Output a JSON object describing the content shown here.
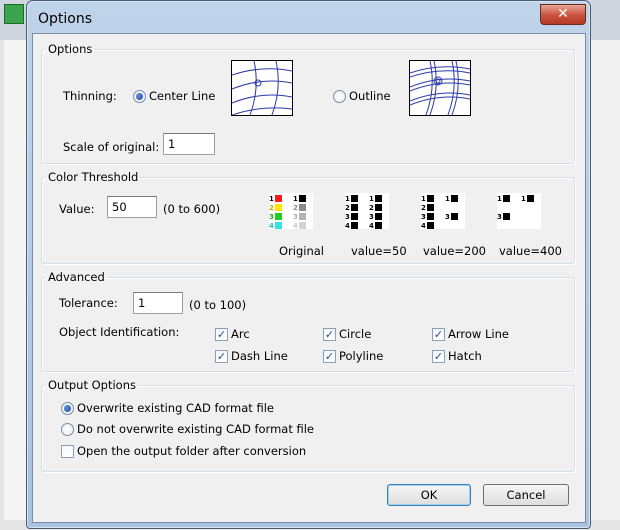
{
  "window": {
    "title": "Options",
    "close_glyph": "✕"
  },
  "options_group": {
    "legend": "Options",
    "thinning_label": "Thinning:",
    "center_line_label": "Center Line",
    "outline_label": "Outline",
    "scale_label": "Scale of original:",
    "scale_value": "1"
  },
  "color_threshold": {
    "legend": "Color Threshold",
    "value_label": "Value:",
    "value": "50",
    "range": "(0 to 600)",
    "previews": [
      {
        "caption": "Original"
      },
      {
        "caption": "value=50"
      },
      {
        "caption": "value=200"
      },
      {
        "caption": "value=400"
      }
    ],
    "colors": {
      "red": "#ff1a1a",
      "yellow": "#ffea00",
      "green": "#22cc22",
      "cyan": "#35e2e2",
      "black": "#000000",
      "gray": "#8c8c8c",
      "lightgray": "#c8c8c8"
    }
  },
  "advanced": {
    "legend": "Advanced",
    "tolerance_label": "Tolerance:",
    "tolerance_value": "1",
    "tolerance_range": "(0 to 100)",
    "object_id_label": "Object Identification:",
    "checkboxes": [
      {
        "label": "Arc",
        "checked": true
      },
      {
        "label": "Circle",
        "checked": true
      },
      {
        "label": "Arrow Line",
        "checked": true
      },
      {
        "label": "Dash Line",
        "checked": true
      },
      {
        "label": "Polyline",
        "checked": true
      },
      {
        "label": "Hatch",
        "checked": true
      }
    ]
  },
  "output": {
    "legend": "Output Options",
    "overwrite_label": "Overwrite existing CAD format file",
    "no_overwrite_label": "Do not overwrite existing CAD format file",
    "open_folder_label": "Open the output folder after conversion"
  },
  "buttons": {
    "ok": "OK",
    "cancel": "Cancel"
  }
}
